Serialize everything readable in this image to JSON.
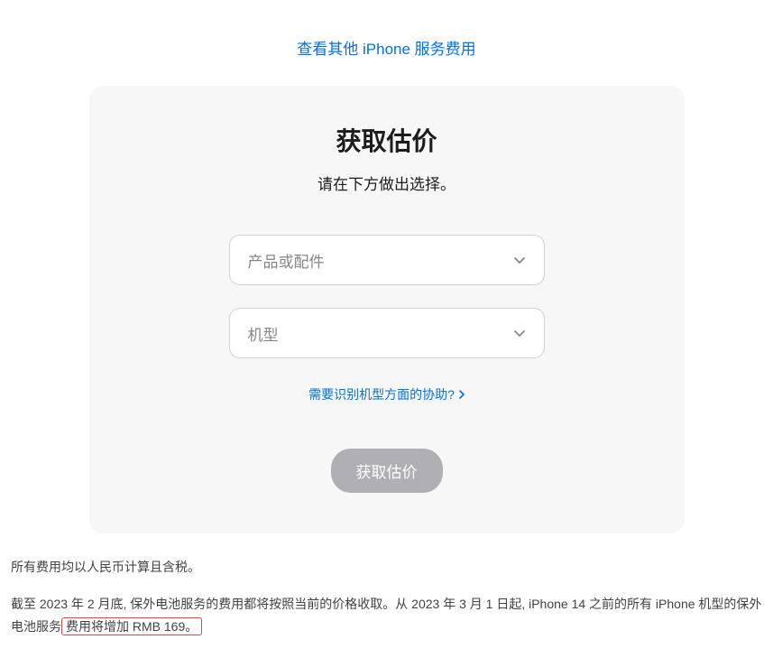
{
  "topLink": {
    "label": "查看其他 iPhone 服务费用"
  },
  "card": {
    "title": "获取估价",
    "subtitle": "请在下方做出选择。",
    "select1": {
      "placeholder": "产品或配件"
    },
    "select2": {
      "placeholder": "机型"
    },
    "helpLink": {
      "label": "需要识别机型方面的协助?"
    },
    "submitButton": {
      "label": "获取估价"
    }
  },
  "footer": {
    "line1": "所有费用均以人民币计算且含税。",
    "line2_part1": "截至 2023 年 2 月底, 保外电池服务的费用都将按照当前的价格收取。从 2023 年 3 月 1 日起, iPhone 14 之前的所有 iPhone 机型的保外电池服务",
    "line2_highlight": "费用将增加 RMB 169。"
  }
}
